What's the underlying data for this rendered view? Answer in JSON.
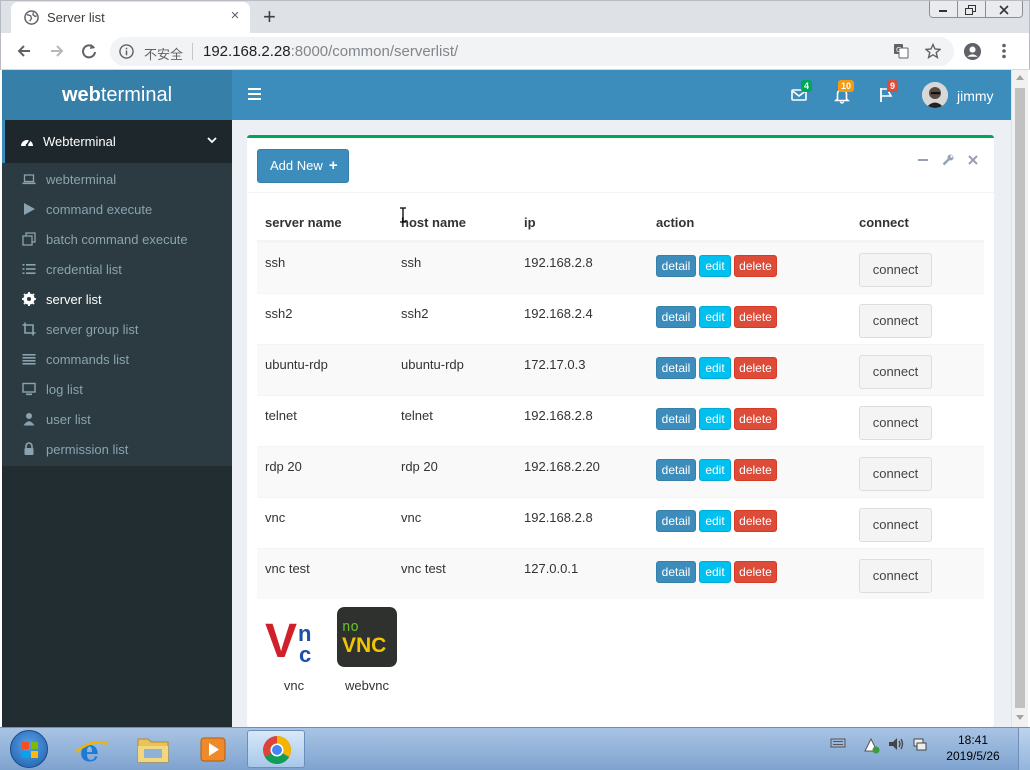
{
  "browser": {
    "tab_title": "Server list",
    "tab_close": "×",
    "new_tab": "+",
    "security_label": "不安全",
    "url_host": "192.168.2.28",
    "url_rest": ":8000/common/serverlist/"
  },
  "header": {
    "logo_bold": "web",
    "logo_rest": "terminal",
    "badges": {
      "messages": "4",
      "notifications": "10",
      "tasks": "9"
    },
    "username": "jimmy"
  },
  "sidebar": {
    "section": "Webterminal",
    "items": [
      {
        "label": "webterminal",
        "icon": "laptop-icon"
      },
      {
        "label": "command execute",
        "icon": "play-icon"
      },
      {
        "label": "batch command execute",
        "icon": "clone-icon"
      },
      {
        "label": "credential list",
        "icon": "list-ol-icon"
      },
      {
        "label": "server list",
        "icon": "cog-icon",
        "active": true
      },
      {
        "label": "server group list",
        "icon": "crop-icon"
      },
      {
        "label": "commands list",
        "icon": "list-icon"
      },
      {
        "label": "log list",
        "icon": "monitor-icon"
      },
      {
        "label": "user list",
        "icon": "user-icon"
      },
      {
        "label": "permission list",
        "icon": "lock-icon"
      }
    ]
  },
  "toolbar": {
    "add_new": "Add New"
  },
  "table": {
    "headers": [
      "server name",
      "host name",
      "ip",
      "action",
      "connect"
    ],
    "actions": {
      "detail": "detail",
      "edit": "edit",
      "delete": "delete",
      "connect": "connect"
    },
    "rows": [
      {
        "server": "ssh",
        "host": "ssh",
        "ip": "192.168.2.8"
      },
      {
        "server": "ssh2",
        "host": "ssh2",
        "ip": "192.168.2.4"
      },
      {
        "server": "ubuntu-rdp",
        "host": "ubuntu-rdp",
        "ip": "172.17.0.3"
      },
      {
        "server": "telnet",
        "host": "telnet",
        "ip": "192.168.2.8"
      },
      {
        "server": "rdp 20",
        "host": "rdp 20",
        "ip": "192.168.2.20"
      },
      {
        "server": "vnc",
        "host": "vnc",
        "ip": "192.168.2.8"
      },
      {
        "server": "vnc test",
        "host": "vnc test",
        "ip": "127.0.0.1"
      }
    ]
  },
  "apps": [
    {
      "label": "vnc",
      "logo_text": "Vnc"
    },
    {
      "label": "webvnc",
      "logo_top": "no",
      "logo_bottom": "VNC"
    }
  ],
  "taskbar": {
    "time": "18:41",
    "date": "2019/5/26"
  },
  "colors": {
    "primary": "#3c8dbc",
    "info": "#00c0ef",
    "danger": "#dd4b39",
    "success": "#00a65a",
    "warning": "#f39c12",
    "sidebar": "#222d32"
  }
}
